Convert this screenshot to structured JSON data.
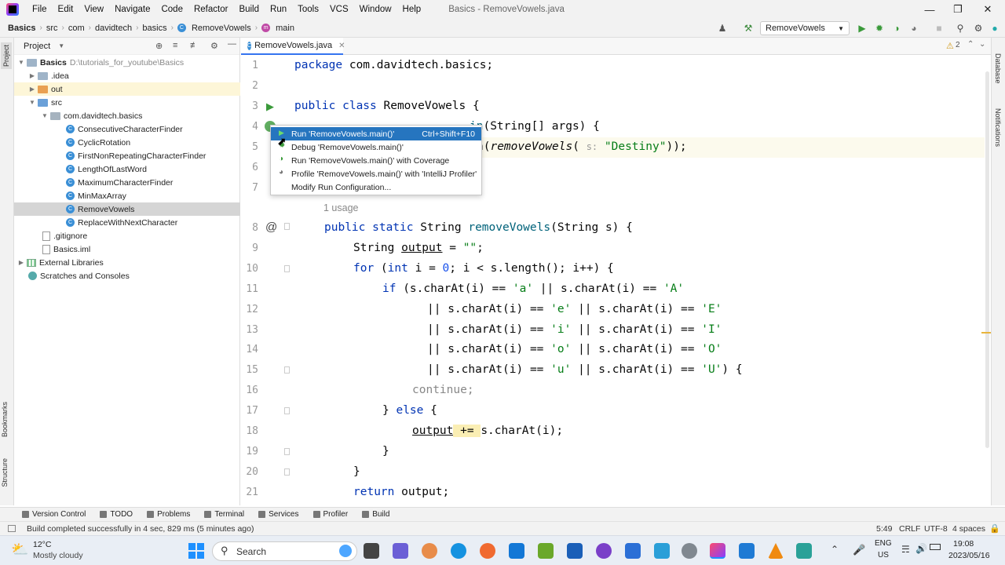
{
  "menubar": {
    "items": [
      "File",
      "Edit",
      "View",
      "Navigate",
      "Code",
      "Refactor",
      "Build",
      "Run",
      "Tools",
      "VCS",
      "Window",
      "Help"
    ],
    "title": "Basics - RemoveVowels.java"
  },
  "breadcrumb": [
    "Basics",
    "src",
    "com",
    "davidtech",
    "basics",
    "RemoveVowels",
    "main"
  ],
  "run_config": "RemoveVowels",
  "project_panel": {
    "title": "Project",
    "root_name": "Basics",
    "root_path": "D:\\tutorials_for_youtube\\Basics",
    "items": [
      ".idea",
      "out",
      "src",
      "com.davidtech.basics",
      "ConsecutiveCharacterFinder",
      "CyclicRotation",
      "FirstNonRepeatingCharacterFinder",
      "LengthOfLastWord",
      "MaximumCharacterFinder",
      "MinMaxArray",
      "RemoveVowels",
      "ReplaceWithNextCharacter",
      ".gitignore",
      "Basics.iml",
      "External Libraries",
      "Scratches and Consoles"
    ]
  },
  "left_stripe": [
    "Project",
    "Bookmarks",
    "Structure"
  ],
  "right_stripe": [
    "Database",
    "Notifications"
  ],
  "editor": {
    "tab": "RemoveVowels.java",
    "warnings": "2",
    "line_numbers": [
      "1",
      "2",
      "3",
      "4",
      "5",
      "6",
      "7",
      "8",
      "9",
      "10",
      "11",
      "12",
      "13",
      "14",
      "15",
      "16",
      "17",
      "18",
      "19",
      "20",
      "21"
    ],
    "usage_hint": "1 usage",
    "code": {
      "l1_kw": "package",
      "l1_rest": " com.davidtech.basics;",
      "l3_kw": "public class",
      "l3_rest": " RemoveVowels {",
      "l4_a": "in",
      "l4_b": "(String[] args) {",
      "l5_a": "n(",
      "l5_fn": "removeVowels",
      "l5_b": "( ",
      "l5_hint": "s:",
      "l5_str": "\"Destiny\"",
      "l5_c": "));",
      "l8_kw": "public static",
      "l8_a": " String ",
      "l8_fn": "removeVowels",
      "l8_b": "(String s) {",
      "l9_a": "String ",
      "l9_b": "output",
      "l9_c": " = ",
      "l9_str": "\"\"",
      "l9_d": ";",
      "l10_kw": "for",
      "l10_a": " (",
      "l10_kw2": "int",
      "l10_b": " i = ",
      "l10_num": "0",
      "l10_c": "; i < s.length(); i++) {",
      "l11_kw": "if",
      "l11_a": " (s.charAt(i) == ",
      "l11_s1": "'a'",
      "l11_b": " || s.charAt(i) == ",
      "l11_s2": "'A'",
      "l12_a": "|| s.charAt(i) == ",
      "l12_s1": "'e'",
      "l12_b": " || s.charAt(i) == ",
      "l12_s2": "'E'",
      "l13_a": "|| s.charAt(i) == ",
      "l13_s1": "'i'",
      "l13_b": " || s.charAt(i) == ",
      "l13_s2": "'I'",
      "l14_a": "|| s.charAt(i) == ",
      "l14_s1": "'o'",
      "l14_b": " || s.charAt(i) == ",
      "l14_s2": "'O'",
      "l15_a": "|| s.charAt(i) == ",
      "l15_s1": "'u'",
      "l15_b": " || s.charAt(i) == ",
      "l15_s2": "'U'",
      "l15_c": ") {",
      "l16_kw": "continue;",
      "l17_a": "} ",
      "l17_kw": "else",
      "l17_b": " {",
      "l18_a": "output",
      "l18_b": " += ",
      "l18_c": "s.charAt(i);",
      "l19": "}",
      "l20": "}",
      "l21_kw": "return",
      "l21_a": " output;"
    }
  },
  "run_popup": {
    "items": [
      {
        "label": "Run 'RemoveVowels.main()'",
        "shortcut": "Ctrl+Shift+F10"
      },
      {
        "label": "Debug 'RemoveVowels.main()'",
        "shortcut": ""
      },
      {
        "label": "Run 'RemoveVowels.main()' with Coverage",
        "shortcut": ""
      },
      {
        "label": "Profile 'RemoveVowels.main()' with 'IntelliJ Profiler'",
        "shortcut": ""
      },
      {
        "label": "Modify Run Configuration...",
        "shortcut": ""
      }
    ]
  },
  "bottom_tools": [
    "Version Control",
    "TODO",
    "Problems",
    "Terminal",
    "Services",
    "Profiler",
    "Build"
  ],
  "status": {
    "message": "Build completed successfully in 4 sec, 829 ms (5 minutes ago)",
    "position": "5:49",
    "line_sep": "CRLF",
    "encoding": "UTF-8",
    "indent": "4 spaces"
  },
  "taskbar": {
    "temp": "12°C",
    "weather": "Mostly cloudy",
    "search": "Search",
    "lang1": "ENG",
    "lang2": "US",
    "time": "19:08",
    "date": "2023/05/16"
  }
}
